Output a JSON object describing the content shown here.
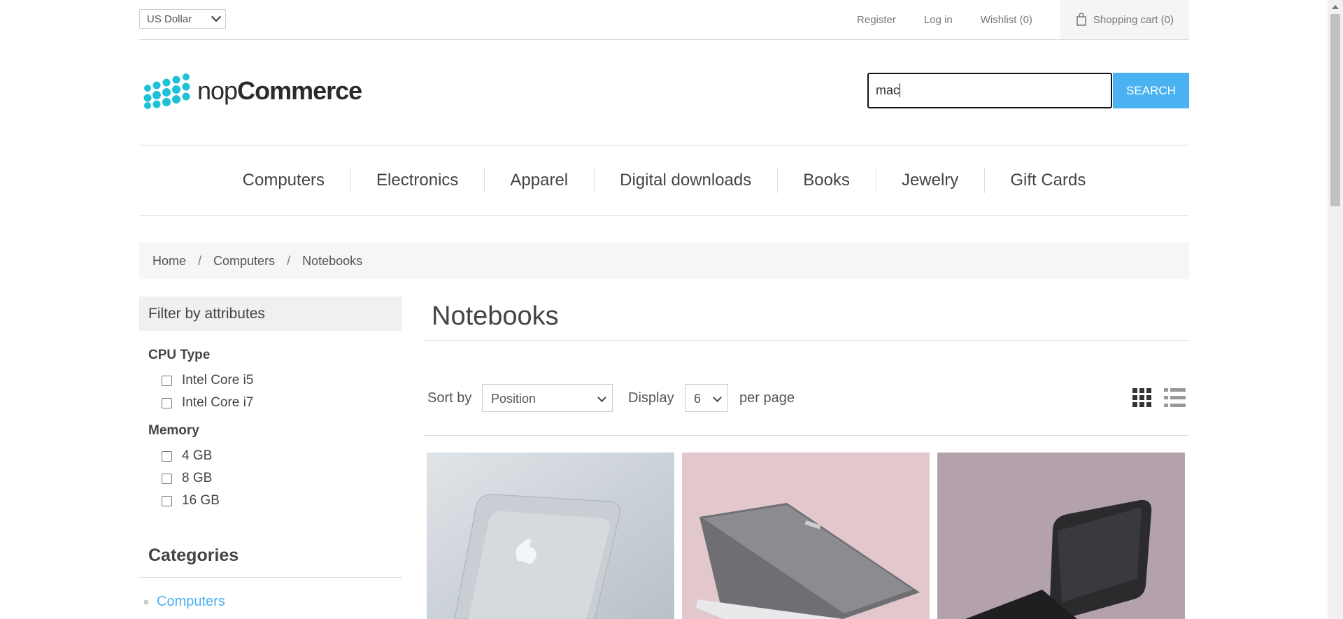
{
  "header": {
    "currency": "US Dollar",
    "links": {
      "register": "Register",
      "login": "Log in",
      "wishlist": "Wishlist (0)",
      "cart": "Shopping cart (0)"
    }
  },
  "logo": {
    "prefix": "nop",
    "suffix": "Commerce"
  },
  "search": {
    "value": "mac",
    "button": "SEARCH"
  },
  "menu": [
    "Computers",
    "Electronics",
    "Apparel",
    "Digital downloads",
    "Books",
    "Jewelry",
    "Gift Cards"
  ],
  "breadcrumb": [
    "Home",
    "Computers",
    "Notebooks"
  ],
  "filter": {
    "title": "Filter by attributes",
    "groups": [
      {
        "name": "CPU Type",
        "options": [
          "Intel Core i5",
          "Intel Core i7"
        ]
      },
      {
        "name": "Memory",
        "options": [
          "4 GB",
          "8 GB",
          "16 GB"
        ]
      }
    ]
  },
  "categories": {
    "title": "Categories",
    "items": [
      "Computers"
    ]
  },
  "main": {
    "title": "Notebooks",
    "sort_label": "Sort by",
    "sort_value": "Position",
    "display_label": "Display",
    "display_value": "6",
    "per_page": "per page"
  },
  "colors": {
    "accent": "#4ab2f1",
    "logo": "#1ec2d8"
  }
}
